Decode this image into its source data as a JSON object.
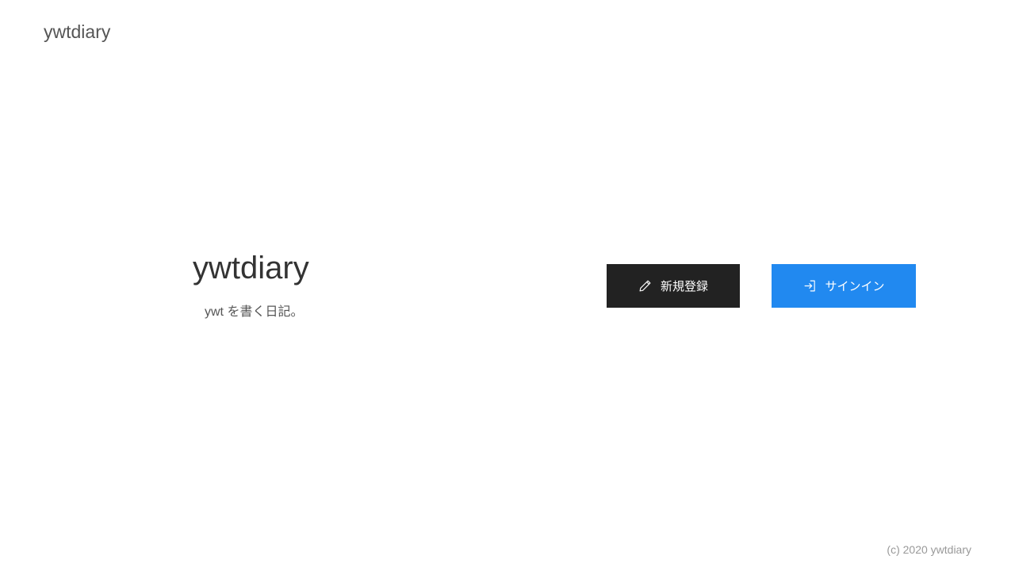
{
  "header": {
    "brand": "ywtdiary"
  },
  "hero": {
    "title": "ywtdiary",
    "subtitle": "ywt を書く日記。"
  },
  "actions": {
    "signup_label": "新規登録",
    "signup_icon": "pencil-icon",
    "signin_label": "サインイン",
    "signin_icon": "sign-in-icon"
  },
  "footer": {
    "copyright": "(c) 2020 ywtdiary"
  },
  "colors": {
    "signup_bg": "#222222",
    "signin_bg": "#2189f0",
    "text_dark": "#333333",
    "text_muted": "#999999"
  }
}
